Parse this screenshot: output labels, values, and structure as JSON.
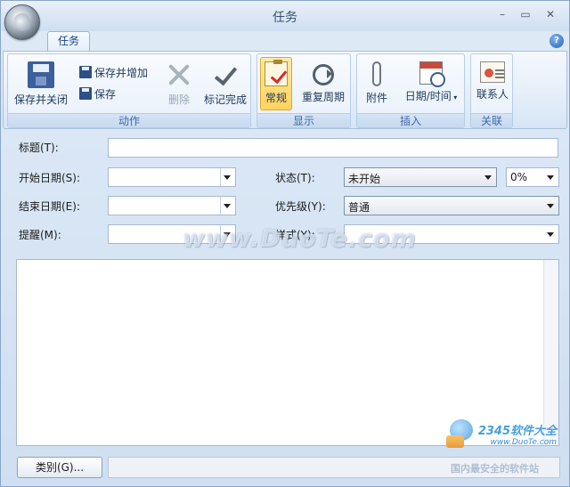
{
  "window": {
    "title": "任务",
    "buttons": {
      "minimize": "–",
      "maximize": "▭",
      "close": "✕"
    }
  },
  "tabs": [
    {
      "label": "任务",
      "active": true
    }
  ],
  "help": "?",
  "ribbon": {
    "groups": {
      "actions": {
        "label": "动作",
        "save_close": "保存并关闭",
        "save_new": "保存并增加",
        "save": "保存",
        "delete": "删除",
        "mark_complete": "标记完成"
      },
      "show": {
        "label": "显示",
        "general": "常规",
        "recurrence": "重复周期"
      },
      "insert": {
        "label": "插入",
        "attachment": "附件",
        "datetime": "日期/时间"
      },
      "link": {
        "label": "关联",
        "contact": "联系人"
      }
    }
  },
  "form": {
    "subject_label": "标题(T):",
    "subject_value": "",
    "start_label": "开始日期(S):",
    "start_value": "",
    "due_label": "结束日期(E):",
    "due_value": "",
    "reminder_label": "提醒(M):",
    "reminder_value": "",
    "status_label": "状态(T):",
    "status_value": "未开始",
    "percent_value": "0%",
    "priority_label": "优先级(Y):",
    "priority_value": "普通",
    "style_label": "样式(Y):",
    "style_value": ""
  },
  "footer": {
    "category_button": "类别(G)..."
  },
  "watermarks": {
    "center": "www.DuoTe.com",
    "corner_logo": "2345软件大全",
    "corner_url": "www.DuoTe.com",
    "corner_bottom": "国内最安全的软件站"
  },
  "colors": {
    "ribbon_label": "#3e6aa8",
    "selected_button": "#ffd35c",
    "window_bg": "#d4e3f4"
  }
}
